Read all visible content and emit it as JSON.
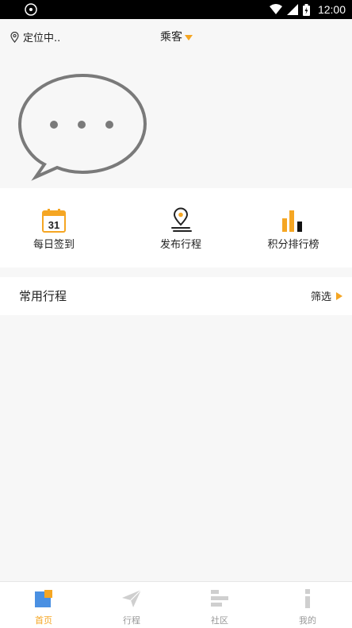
{
  "status_bar": {
    "time": "12:00"
  },
  "header": {
    "location": "定位中..",
    "role": "乘客"
  },
  "quick_actions": [
    {
      "label": "每日签到",
      "calendar_day": "31"
    },
    {
      "label": "发布行程"
    },
    {
      "label": "积分排行榜"
    }
  ],
  "common_trips": {
    "title": "常用行程",
    "filter_label": "筛选"
  },
  "tabs": [
    {
      "label": "首页",
      "active": true
    },
    {
      "label": "行程",
      "active": false
    },
    {
      "label": "社区",
      "active": false
    },
    {
      "label": "我的",
      "active": false
    }
  ],
  "colors": {
    "accent": "#f5a623",
    "inactive": "#bbbbbb",
    "home_blue": "#4a90e2"
  }
}
